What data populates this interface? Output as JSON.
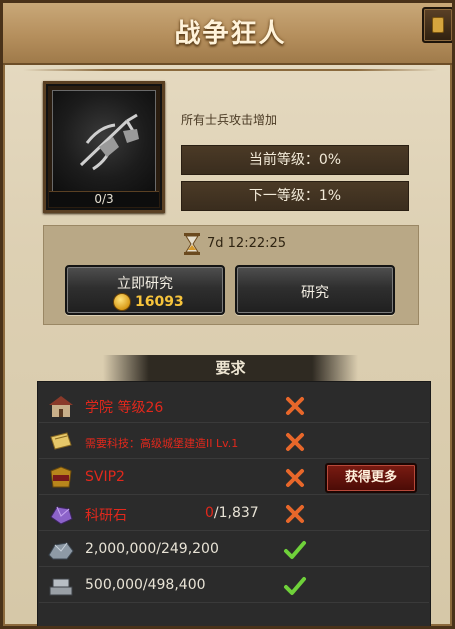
{
  "window": {
    "title": "战争狂人"
  },
  "skill": {
    "progress": "0/3",
    "description": "所有士兵攻击增加",
    "current_level": "当前等级：0%",
    "next_level": "下一等级：1%"
  },
  "research": {
    "timer": "7d 12:22:25",
    "instant_label": "立即研究",
    "instant_cost": "16093",
    "research_label": "研究"
  },
  "requirements": {
    "header": "要求",
    "items": [
      {
        "text": "学院 等级26",
        "icon": "academy-icon",
        "met": false
      },
      {
        "text": "需要科技：高级城堡建造II Lv.1",
        "icon": "scroll-icon",
        "met": false
      },
      {
        "text": "SVIP2",
        "icon": "svip-icon",
        "met": false,
        "action": "获得更多"
      },
      {
        "text": "科研石",
        "current": "0",
        "required": "/1,837",
        "icon": "research-stone-icon",
        "met": false
      },
      {
        "text": "2,000,000/249,200",
        "icon": "stone-ore-icon",
        "met": true
      },
      {
        "text": "500,000/498,400",
        "icon": "iron-ore-icon",
        "met": true
      }
    ]
  },
  "colors": {
    "unmet": "#e1281c",
    "met": "#6fd13a",
    "accent": "#f7c43c"
  }
}
